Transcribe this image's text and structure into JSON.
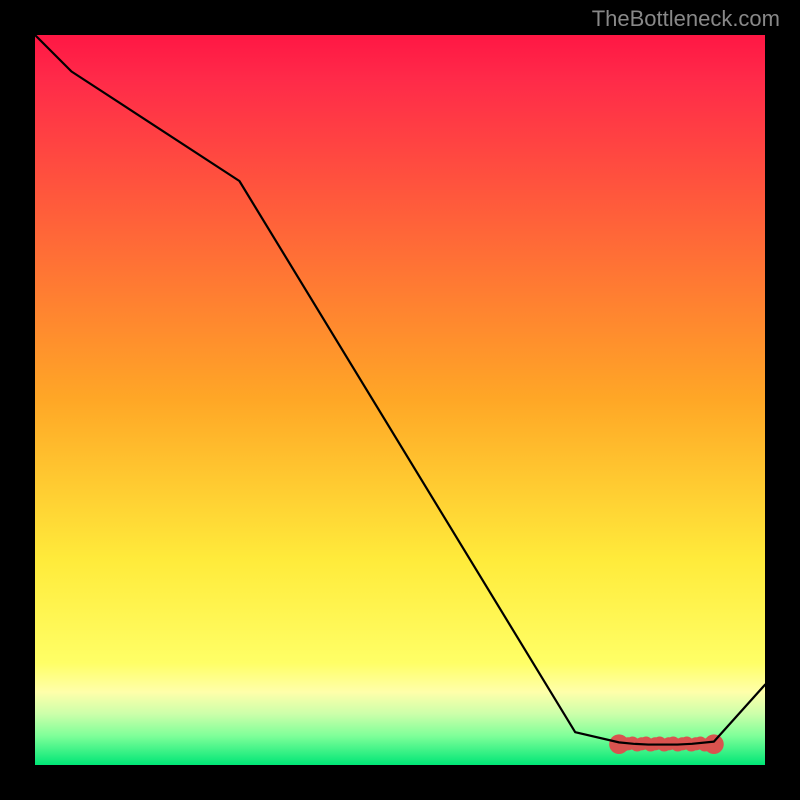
{
  "attribution": "TheBottleneck.com",
  "chart_data": {
    "type": "line",
    "title": "",
    "xlabel": "",
    "ylabel": "",
    "xlim": [
      0,
      100
    ],
    "ylim": [
      0,
      100
    ],
    "background_gradient": {
      "stops": [
        {
          "offset": 0.0,
          "color": "#ff1744"
        },
        {
          "offset": 0.06,
          "color": "#ff2a49"
        },
        {
          "offset": 0.5,
          "color": "#ffa726"
        },
        {
          "offset": 0.72,
          "color": "#ffeb3b"
        },
        {
          "offset": 0.86,
          "color": "#ffff66"
        },
        {
          "offset": 0.9,
          "color": "#ffffaa"
        },
        {
          "offset": 0.93,
          "color": "#ccffaa"
        },
        {
          "offset": 0.96,
          "color": "#7fff99"
        },
        {
          "offset": 1.0,
          "color": "#00e676"
        }
      ]
    },
    "series": [
      {
        "name": "curve",
        "x": [
          0,
          5,
          28,
          74,
          80,
          82,
          84,
          86,
          88,
          90,
          93,
          100
        ],
        "y": [
          100,
          95,
          80,
          4.5,
          3.1,
          2.9,
          2.8,
          2.8,
          2.8,
          2.9,
          3.2,
          11
        ]
      }
    ],
    "markers": {
      "name": "bottleneck-zone",
      "radius_data_units": 0.9,
      "fill": "#d9534f",
      "cluster": {
        "x_start": 80,
        "x_end": 93,
        "count": 22,
        "y": 2.85
      }
    }
  }
}
